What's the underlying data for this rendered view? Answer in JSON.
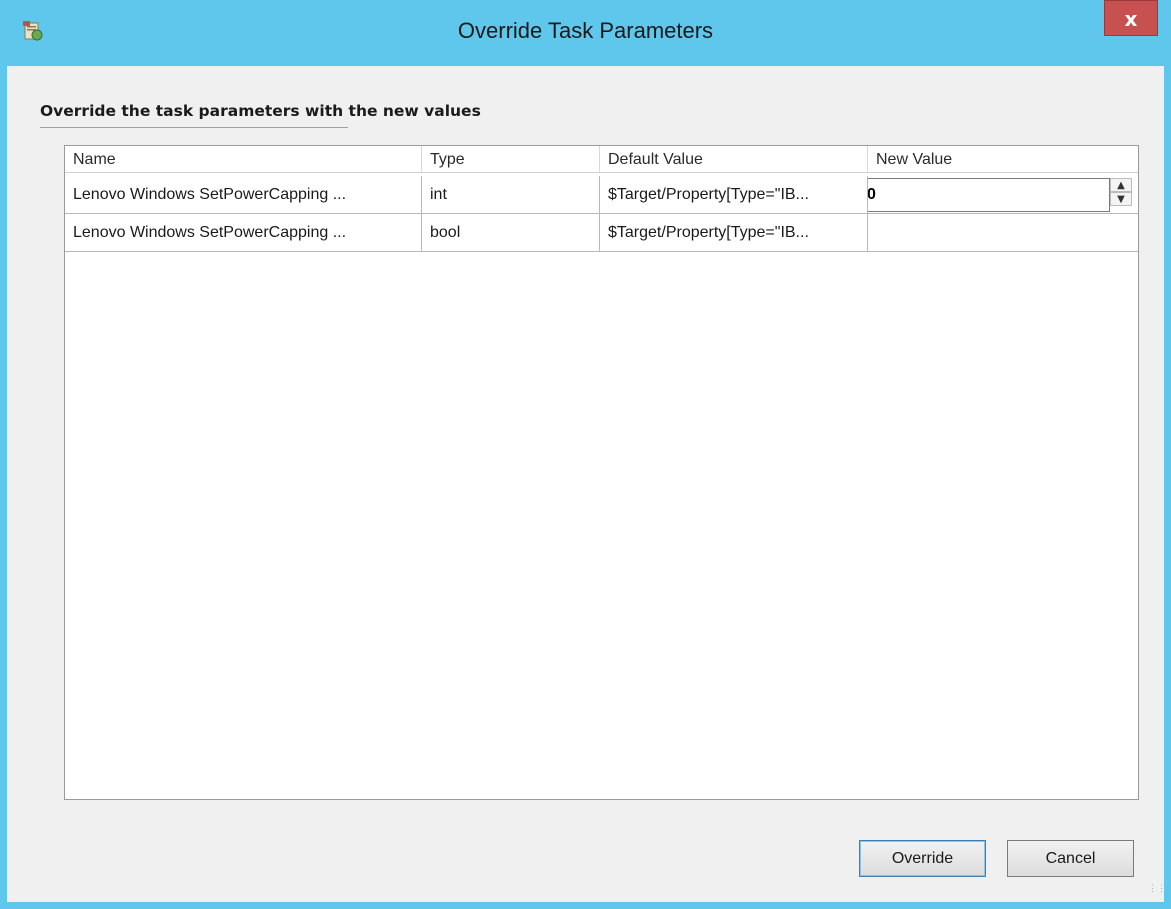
{
  "window": {
    "title": "Override Task Parameters",
    "close_label": "x",
    "app_icon": "task-parameters-icon"
  },
  "heading": "Override the task parameters with the new values",
  "grid": {
    "columns": [
      "Name",
      "Type",
      "Default Value",
      "New Value"
    ],
    "rows": [
      {
        "name": "Lenovo Windows SetPowerCapping ...",
        "type": "int",
        "default": "$Target/Property[Type=\"IB...",
        "new_value": "0"
      },
      {
        "name": "Lenovo Windows SetPowerCapping ...",
        "type": "bool",
        "default": "$Target/Property[Type=\"IB...",
        "new_value": ""
      }
    ]
  },
  "buttons": {
    "override": "Override",
    "cancel": "Cancel"
  },
  "colors": {
    "title_bar": "#5fc6ec",
    "close_button": "#c75050",
    "client_background": "#f0f0f0"
  }
}
